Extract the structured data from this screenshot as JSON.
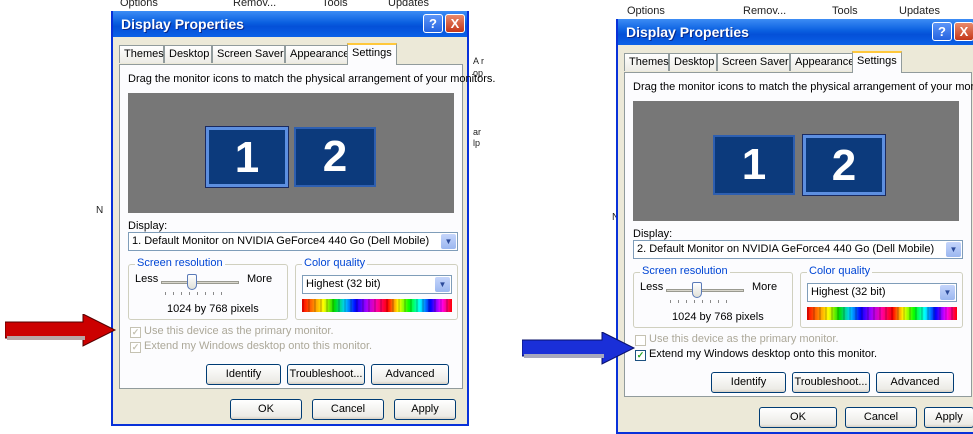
{
  "background_fragments": {
    "left": {
      "options": "Options",
      "remove": "Remov...",
      "tools": "Tools",
      "updates": "Updates",
      "side1": "A r",
      "side2": "op",
      "side3": "ar",
      "side4": "lp",
      "n": "N"
    },
    "right": {
      "options": "Options",
      "remove": "Remov...",
      "tools": "Tools",
      "updates": "Updates",
      "n": "N"
    }
  },
  "dialogs": [
    {
      "title": "Display Properties",
      "help_label": "?",
      "close_label": "X",
      "tabs": [
        "Themes",
        "Desktop",
        "Screen Saver",
        "Appearance",
        "Settings"
      ],
      "active_tab": "Settings",
      "instruction": "Drag the monitor icons to match the physical arrangement of your monitors.",
      "monitor_1": "1",
      "monitor_2": "2",
      "selected_monitor": "1",
      "display_label": "Display:",
      "display_value": "1. Default Monitor on NVIDIA GeForce4 440 Go (Dell Mobile)",
      "screen_resolution_label": "Screen resolution",
      "less_label": "Less",
      "more_label": "More",
      "resolution_value": "1024 by 768 pixels",
      "color_quality_label": "Color quality",
      "color_quality_value": "Highest (32 bit)",
      "primary_monitor_label": "Use this device as the primary monitor.",
      "primary_checked": true,
      "primary_disabled": true,
      "extend_label": "Extend my Windows desktop onto this monitor.",
      "extend_checked": true,
      "extend_disabled": true,
      "identify_label": "Identify",
      "troubleshoot_label": "Troubleshoot...",
      "advanced_label": "Advanced",
      "ok_label": "OK",
      "cancel_label": "Cancel",
      "apply_label": "Apply",
      "arrow_color": "#cc0000"
    },
    {
      "title": "Display Properties",
      "help_label": "?",
      "close_label": "X",
      "tabs": [
        "Themes",
        "Desktop",
        "Screen Saver",
        "Appearance",
        "Settings"
      ],
      "active_tab": "Settings",
      "instruction": "Drag the monitor icons to match the physical arrangement of your monitors.",
      "monitor_1": "1",
      "monitor_2": "2",
      "selected_monitor": "2",
      "display_label": "Display:",
      "display_value": "2. Default Monitor on NVIDIA GeForce4 440 Go (Dell Mobile)",
      "screen_resolution_label": "Screen resolution",
      "less_label": "Less",
      "more_label": "More",
      "resolution_value": "1024 by 768 pixels",
      "color_quality_label": "Color quality",
      "color_quality_value": "Highest (32 bit)",
      "primary_monitor_label": "Use this device as the primary monitor.",
      "primary_checked": false,
      "primary_disabled": true,
      "extend_label": "Extend my Windows desktop onto this monitor.",
      "extend_checked": true,
      "extend_disabled": false,
      "identify_label": "Identify",
      "troubleshoot_label": "Troubleshoot...",
      "advanced_label": "Advanced",
      "ok_label": "OK",
      "cancel_label": "Cancel",
      "apply_label": "Apply",
      "arrow_color": "#1a2fd8"
    }
  ]
}
